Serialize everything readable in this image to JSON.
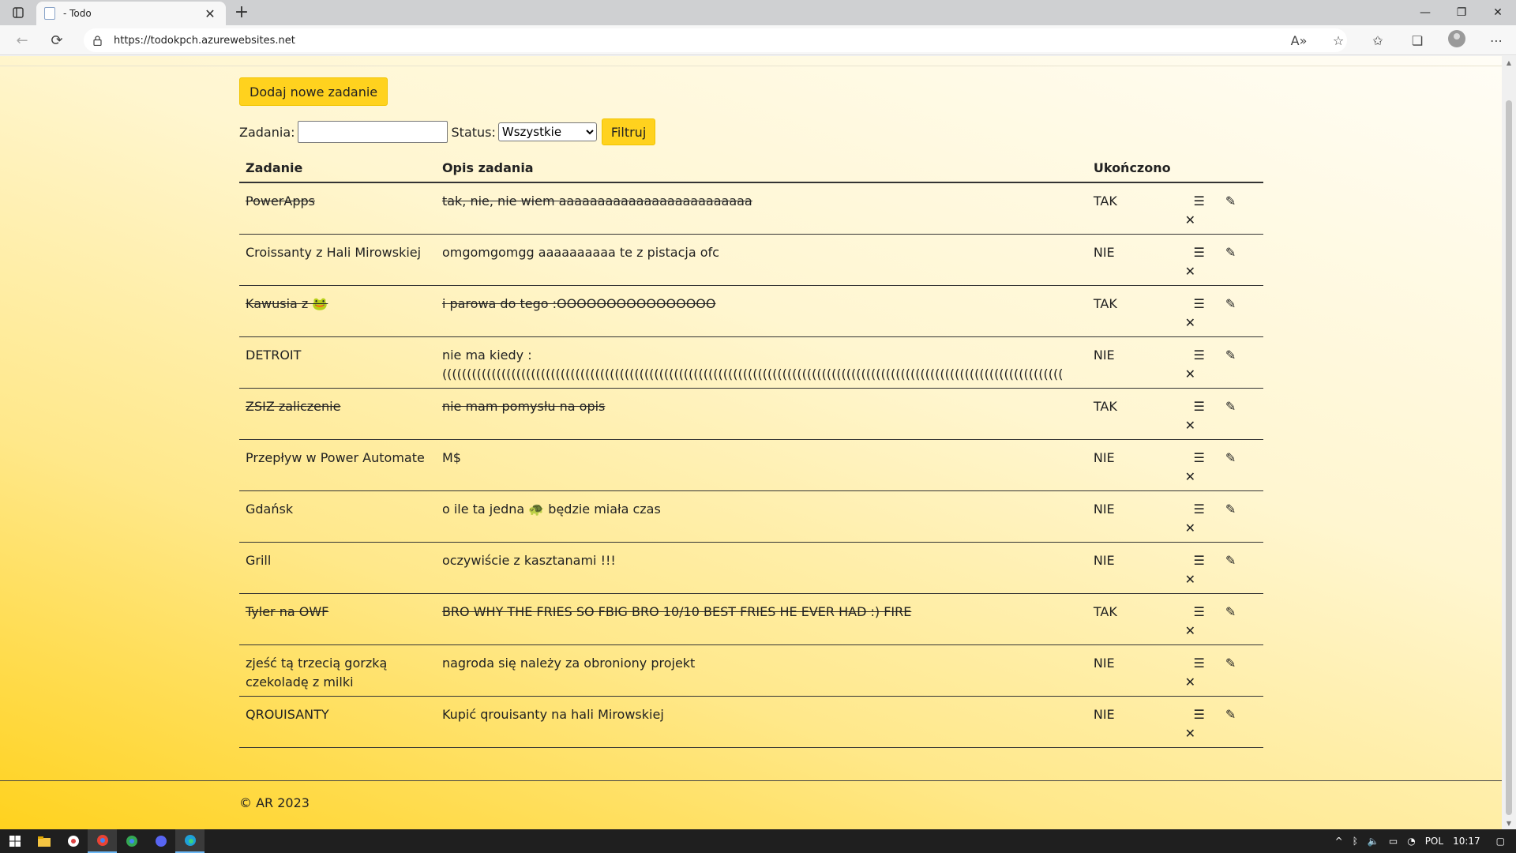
{
  "browser": {
    "tab_title": "- Todo",
    "tab_close": "✕",
    "new_tab": "+",
    "url": "https://todokpch.azurewebsites.net",
    "window_controls": {
      "minimize": "—",
      "maximize": "❐",
      "close": "✕"
    }
  },
  "page": {
    "add_button": "Dodaj nowe zadanie",
    "filter": {
      "task_label": "Zadania:",
      "task_value": "",
      "status_label": "Status:",
      "status_selected": "Wszystkie",
      "submit": "Filtruj"
    },
    "table": {
      "headers": {
        "task": "Zadanie",
        "description": "Opis zadania",
        "completed": "Ukończono"
      },
      "rows": [
        {
          "task": "PowerApps",
          "description": "tak, nie, nie wiem aaaaaaaaaaaaaaaaaaaaaaaaa",
          "completed": "TAK",
          "done": true
        },
        {
          "task": "Croissanty z Hali Mirowskiej",
          "description": "omgomgomgg aaaaaaaaaa te z pistacja ofc",
          "completed": "NIE",
          "done": false
        },
        {
          "task": "Kawusia z 🐸",
          "description": "i parowa do tego :OOOOOOOOOOOOOOOO",
          "completed": "TAK",
          "done": true
        },
        {
          "task": "DETROIT",
          "description": "nie ma kiedy : ((((((((((((((((((((((((((((((((((((((((((((((((((((((((((((((((((((((((((((((((((((((((((((((((((((((((((((((((((((((((((((((",
          "completed": "NIE",
          "done": false
        },
        {
          "task": "ZSIZ zaliczenie",
          "description": "nie mam pomysłu na opis",
          "completed": "TAK",
          "done": true
        },
        {
          "task": "Przepływ w Power Automate",
          "description": "M$",
          "completed": "NIE",
          "done": false
        },
        {
          "task": "Gdańsk",
          "description": "o ile ta jedna 🐢 będzie miała czas",
          "completed": "NIE",
          "done": false
        },
        {
          "task": "Grill",
          "description": "oczywiście z kasztanami !!!",
          "completed": "NIE",
          "done": false
        },
        {
          "task": "Tyler na OWF",
          "description": "BRO WHY THE FRIES SO FBIG BRO 10/10 BEST FRIES HE EVER HAD :) FIRE",
          "completed": "TAK",
          "done": true
        },
        {
          "task": "zjeść tą trzecią gorzką czekoladę z milki",
          "description": "nagroda się należy za obroniony projekt",
          "completed": "NIE",
          "done": false
        },
        {
          "task": "QROUISANTY",
          "description": "Kupić qrouisanty na hali Mirowskiej",
          "completed": "NIE",
          "done": false
        }
      ],
      "action_icons": {
        "details": "☰",
        "edit": "✎",
        "delete": "✕"
      }
    },
    "footer": "© AR 2023"
  },
  "taskbar": {
    "language": "POL",
    "time": "10:17"
  },
  "colors": {
    "accent": "#ffd21e"
  }
}
